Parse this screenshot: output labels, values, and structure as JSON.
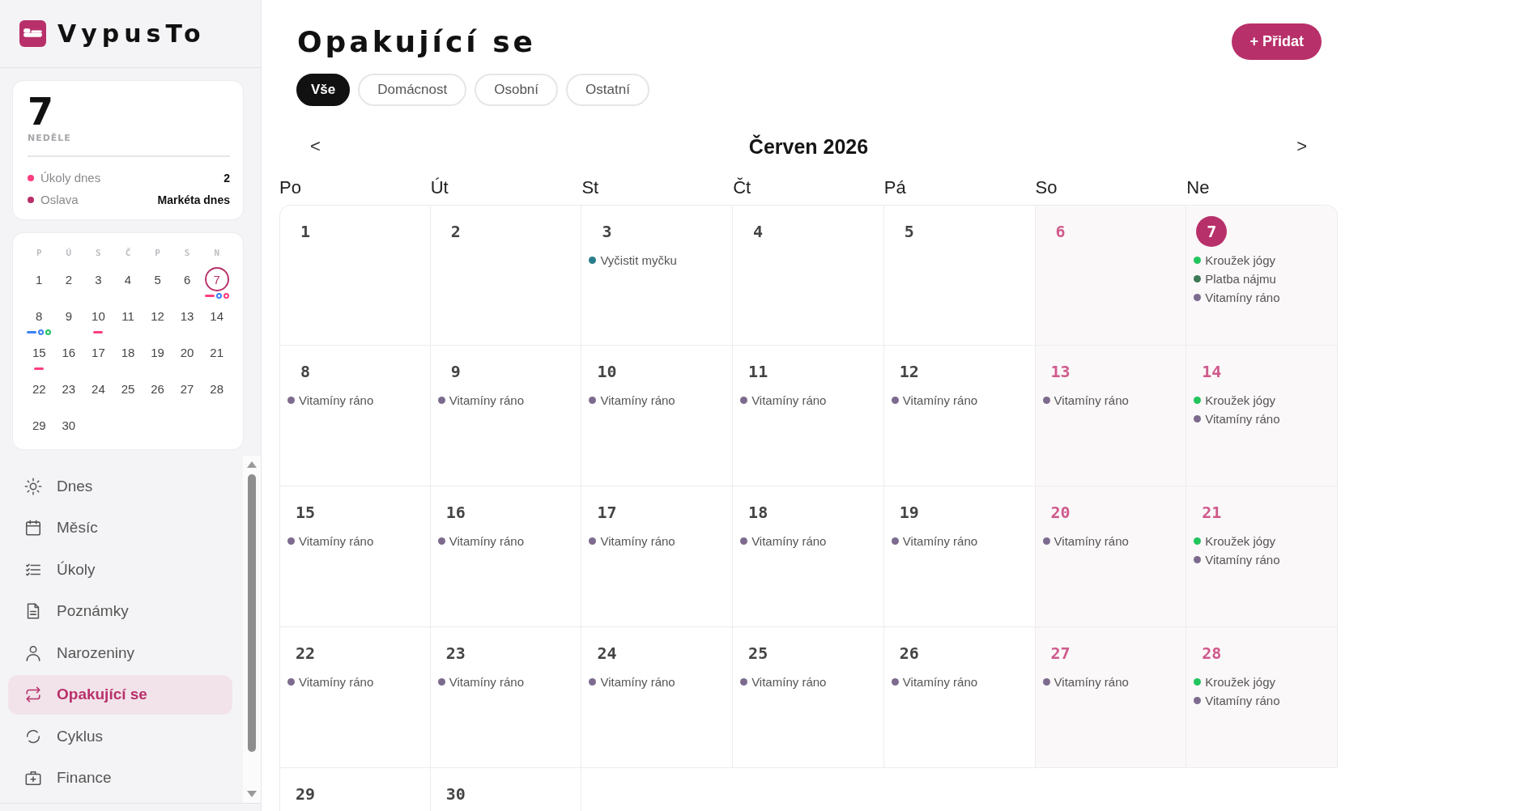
{
  "app": {
    "name": "VypusTo"
  },
  "today_card": {
    "day": "7",
    "weekday": "NEDĚLE",
    "rows": [
      {
        "label": "Úkoly dnes",
        "value": "2",
        "color": "#ff3d7f"
      },
      {
        "label": "Oslava",
        "value": "Markéta dnes",
        "color": "#b8306a"
      }
    ]
  },
  "mini_calendar": {
    "weekdays": [
      "P",
      "Ú",
      "S",
      "Č",
      "P",
      "S",
      "N"
    ],
    "days": [
      {
        "label": "1",
        "today": false
      },
      {
        "label": "2",
        "today": false
      },
      {
        "label": "3",
        "today": false
      },
      {
        "label": "4",
        "today": false
      },
      {
        "label": "5",
        "today": false
      },
      {
        "label": "6",
        "today": false
      },
      {
        "label": "7",
        "today": true,
        "markers": [
          {
            "kind": "bar",
            "color": "#ff3d7f"
          },
          {
            "kind": "ring",
            "color": "#3b82f6"
          },
          {
            "kind": "ring",
            "color": "#ff3d7f"
          }
        ]
      },
      {
        "label": "8",
        "today": false,
        "markers": [
          {
            "kind": "bar",
            "color": "#3b82f6"
          },
          {
            "kind": "ring",
            "color": "#3b82f6"
          },
          {
            "kind": "ring",
            "color": "#22c55e"
          }
        ]
      },
      {
        "label": "9",
        "today": false
      },
      {
        "label": "10",
        "today": false,
        "markers": [
          {
            "kind": "bar",
            "color": "#ff3d7f"
          }
        ]
      },
      {
        "label": "11",
        "today": false
      },
      {
        "label": "12",
        "today": false
      },
      {
        "label": "13",
        "today": false
      },
      {
        "label": "14",
        "today": false
      },
      {
        "label": "15",
        "today": false,
        "markers": [
          {
            "kind": "bar",
            "color": "#ff3d7f"
          }
        ]
      },
      {
        "label": "16",
        "today": false
      },
      {
        "label": "17",
        "today": false
      },
      {
        "label": "18",
        "today": false
      },
      {
        "label": "19",
        "today": false
      },
      {
        "label": "20",
        "today": false
      },
      {
        "label": "21",
        "today": false
      },
      {
        "label": "22",
        "today": false
      },
      {
        "label": "23",
        "today": false
      },
      {
        "label": "24",
        "today": false
      },
      {
        "label": "25",
        "today": false
      },
      {
        "label": "26",
        "today": false
      },
      {
        "label": "27",
        "today": false
      },
      {
        "label": "28",
        "today": false
      },
      {
        "label": "29",
        "today": false
      },
      {
        "label": "30",
        "today": false
      }
    ]
  },
  "nav": [
    {
      "label": "Dnes",
      "selected": false
    },
    {
      "label": "Měsíc",
      "selected": false
    },
    {
      "label": "Úkoly",
      "selected": false
    },
    {
      "label": "Poznámky",
      "selected": false
    },
    {
      "label": "Narozeniny",
      "selected": false
    },
    {
      "label": "Opakující se",
      "selected": true
    },
    {
      "label": "Cyklus",
      "selected": false
    },
    {
      "label": "Finance",
      "selected": false
    }
  ],
  "page": {
    "title": "Opakující se",
    "add_button": "+ Přidat"
  },
  "filters": [
    {
      "label": "Vše",
      "selected": true
    },
    {
      "label": "Domácnost",
      "selected": false
    },
    {
      "label": "Osobní",
      "selected": false
    },
    {
      "label": "Ostatní",
      "selected": false
    }
  ],
  "calendar": {
    "prev": "<",
    "month": "Červen 2026",
    "next": ">",
    "weekdays": [
      "Po",
      "Út",
      "St",
      "Čt",
      "Pá",
      "So",
      "Ne"
    ],
    "days": [
      {
        "label": "1",
        "weekend": false,
        "today": false
      },
      {
        "label": "2",
        "weekend": false,
        "today": false
      },
      {
        "label": "3",
        "weekend": false,
        "today": false,
        "events": [
          {
            "label": "Vyčistit myčku",
            "color": "#2a7d8c"
          }
        ]
      },
      {
        "label": "4",
        "weekend": false,
        "today": false
      },
      {
        "label": "5",
        "weekend": false,
        "today": false
      },
      {
        "label": "6",
        "weekend": true,
        "today": false
      },
      {
        "label": "7",
        "weekend": true,
        "today": true,
        "events": [
          {
            "label": "Kroužek jógy",
            "color": "#22c55e"
          },
          {
            "label": "Platba nájmu",
            "color": "#3f7a57"
          },
          {
            "label": "Vitamíny ráno",
            "color": "#7d6b8f"
          }
        ]
      },
      {
        "label": "8",
        "weekend": false,
        "today": false,
        "events": [
          {
            "label": "Vitamíny ráno",
            "color": "#7d6b8f"
          }
        ]
      },
      {
        "label": "9",
        "weekend": false,
        "today": false,
        "events": [
          {
            "label": "Vitamíny ráno",
            "color": "#7d6b8f"
          }
        ]
      },
      {
        "label": "10",
        "weekend": false,
        "today": false,
        "events": [
          {
            "label": "Vitamíny ráno",
            "color": "#7d6b8f"
          }
        ]
      },
      {
        "label": "11",
        "weekend": false,
        "today": false,
        "events": [
          {
            "label": "Vitamíny ráno",
            "color": "#7d6b8f"
          }
        ]
      },
      {
        "label": "12",
        "weekend": false,
        "today": false,
        "events": [
          {
            "label": "Vitamíny ráno",
            "color": "#7d6b8f"
          }
        ]
      },
      {
        "label": "13",
        "weekend": true,
        "today": false,
        "events": [
          {
            "label": "Vitamíny ráno",
            "color": "#7d6b8f"
          }
        ]
      },
      {
        "label": "14",
        "weekend": true,
        "today": false,
        "events": [
          {
            "label": "Kroužek jógy",
            "color": "#22c55e"
          },
          {
            "label": "Vitamíny ráno",
            "color": "#7d6b8f"
          }
        ]
      },
      {
        "label": "15",
        "weekend": false,
        "today": false,
        "events": [
          {
            "label": "Vitamíny ráno",
            "color": "#7d6b8f"
          }
        ]
      },
      {
        "label": "16",
        "weekend": false,
        "today": false,
        "events": [
          {
            "label": "Vitamíny ráno",
            "color": "#7d6b8f"
          }
        ]
      },
      {
        "label": "17",
        "weekend": false,
        "today": false,
        "events": [
          {
            "label": "Vitamíny ráno",
            "color": "#7d6b8f"
          }
        ]
      },
      {
        "label": "18",
        "weekend": false,
        "today": false,
        "events": [
          {
            "label": "Vitamíny ráno",
            "color": "#7d6b8f"
          }
        ]
      },
      {
        "label": "19",
        "weekend": false,
        "today": false,
        "events": [
          {
            "label": "Vitamíny ráno",
            "color": "#7d6b8f"
          }
        ]
      },
      {
        "label": "20",
        "weekend": true,
        "today": false,
        "events": [
          {
            "label": "Vitamíny ráno",
            "color": "#7d6b8f"
          }
        ]
      },
      {
        "label": "21",
        "weekend": true,
        "today": false,
        "events": [
          {
            "label": "Kroužek jógy",
            "color": "#22c55e"
          },
          {
            "label": "Vitamíny ráno",
            "color": "#7d6b8f"
          }
        ]
      },
      {
        "label": "22",
        "weekend": false,
        "today": false,
        "events": [
          {
            "label": "Vitamíny ráno",
            "color": "#7d6b8f"
          }
        ]
      },
      {
        "label": "23",
        "weekend": false,
        "today": false,
        "events": [
          {
            "label": "Vitamíny ráno",
            "color": "#7d6b8f"
          }
        ]
      },
      {
        "label": "24",
        "weekend": false,
        "today": false,
        "events": [
          {
            "label": "Vitamíny ráno",
            "color": "#7d6b8f"
          }
        ]
      },
      {
        "label": "25",
        "weekend": false,
        "today": false,
        "events": [
          {
            "label": "Vitamíny ráno",
            "color": "#7d6b8f"
          }
        ]
      },
      {
        "label": "26",
        "weekend": false,
        "today": false,
        "events": [
          {
            "label": "Vitamíny ráno",
            "color": "#7d6b8f"
          }
        ]
      },
      {
        "label": "27",
        "weekend": true,
        "today": false,
        "events": [
          {
            "label": "Vitamíny ráno",
            "color": "#7d6b8f"
          }
        ]
      },
      {
        "label": "28",
        "weekend": true,
        "today": false,
        "events": [
          {
            "label": "Kroužek jógy",
            "color": "#22c55e"
          },
          {
            "label": "Vitamíny ráno",
            "color": "#7d6b8f"
          }
        ]
      },
      {
        "label": "29",
        "weekend": false,
        "today": false
      },
      {
        "label": "30",
        "weekend": false,
        "today": false
      }
    ]
  }
}
